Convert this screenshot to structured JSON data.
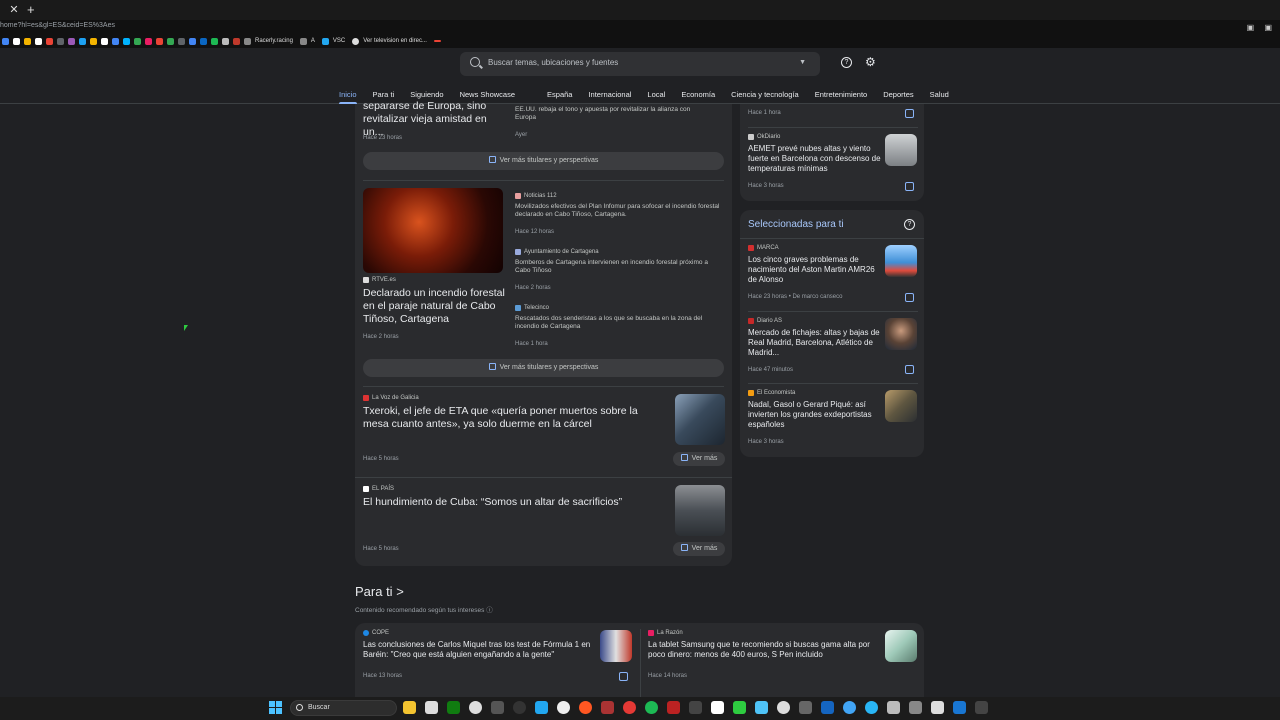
{
  "browser": {
    "url": "home?hl=es&gl=ES&ceid=ES%3Aes",
    "bookmarks": [
      "Racerly.racing",
      "A",
      "VSC",
      "Ver television en direc..."
    ]
  },
  "header": {
    "search_placeholder": "Buscar temas, ubicaciones y fuentes",
    "nav": [
      "Inicio",
      "Para ti",
      "Siguiendo",
      "News Showcase",
      "España",
      "Internacional",
      "Local",
      "Economía",
      "Ciencia y tecnología",
      "Entretenimiento",
      "Deportes",
      "Salud"
    ]
  },
  "main": {
    "top": {
      "title": "separarse de Europa, sino revitalizar vieja amistad en un...",
      "time": "Hace 23 horas",
      "related_text": "EE.UU. rebaja el tono y apuesta por revitalizar la alianza con Europa",
      "related_time": "Ayer",
      "more": "Ver más titulares y perspectivas"
    },
    "fire": {
      "source": "RTVE.es",
      "title": "Declarado un incendio forestal en el paraje natural de Cabo Tiñoso, Cartagena",
      "time": "Hace 2 horas",
      "related": [
        {
          "source": "Noticias 112",
          "text": "Movilizados efectivos del Plan Infomur para sofocar el incendio forestal declarado en Cabo Tiñoso, Cartagena.",
          "time": "Hace 12 horas"
        },
        {
          "source": "Ayuntamiento de Cartagena",
          "text": "Bomberos de Cartagena intervienen en incendio forestal próximo a Cabo Tiñoso",
          "time": "Hace 2 horas"
        },
        {
          "source": "Telecinco",
          "text": "Rescatados dos senderistas a los que se buscaba en la zona del incendio de Cartagena",
          "time": "Hace 1 hora"
        }
      ],
      "more": "Ver más titulares y perspectivas"
    },
    "txeroki": {
      "source": "La Voz de Galicia",
      "title": "Txeroki, el jefe de ETA que «quería poner muertos sobre la mesa cuanto antes», ya solo duerme en la cárcel",
      "time": "Hace 5 horas",
      "more": "Ver más"
    },
    "cuba": {
      "source": "EL PAÍS",
      "title": "El hundimiento de Cuba: “Somos un altar de sacrificios”",
      "time": "Hace 5 horas",
      "more": "Ver más"
    }
  },
  "side": {
    "top_time": "Hace 1 hora",
    "aemet": {
      "source": "OkDiario",
      "title": "AEMET prevé nubes altas y viento fuerte en Barcelona con descenso de temperaturas mínimas",
      "time": "Hace 3 horas"
    },
    "selected_title": "Seleccionadas para ti",
    "items": [
      {
        "source": "MARCA",
        "title": "Los cinco graves problemas de nacimiento del Aston Martin AMR26 de Alonso",
        "time": "Hace 23 horas • De marco canseco"
      },
      {
        "source": "Diario AS",
        "title": "Mercado de fichajes: altas y bajas de Real Madrid, Barcelona, Atlético de Madrid...",
        "time": "Hace 47 minutos"
      },
      {
        "source": "El Economista",
        "title": "Nadal, Gasol o Gerard Piqué: así invierten los grandes exdeportistas españoles",
        "time": "Hace 3 horas"
      }
    ]
  },
  "para_ti": {
    "title": "Para ti",
    "chevron": ">",
    "subtitle": "Contenido recomendado según tus intereses",
    "items": [
      {
        "source": "COPE",
        "title": "Las conclusiones de Carlos Miquel tras los test de Fórmula 1 en Baréin: \"Creo que está alguien engañando a la gente\"",
        "time": "Hace 13 horas"
      },
      {
        "source": "La Razón",
        "title": "La tablet Samsung que te recomiendo si buscas gama alta por poco dinero: menos de 400 euros, S Pen incluido",
        "time": "Hace 14 horas"
      }
    ]
  },
  "taskbar": {
    "search": "Buscar"
  }
}
